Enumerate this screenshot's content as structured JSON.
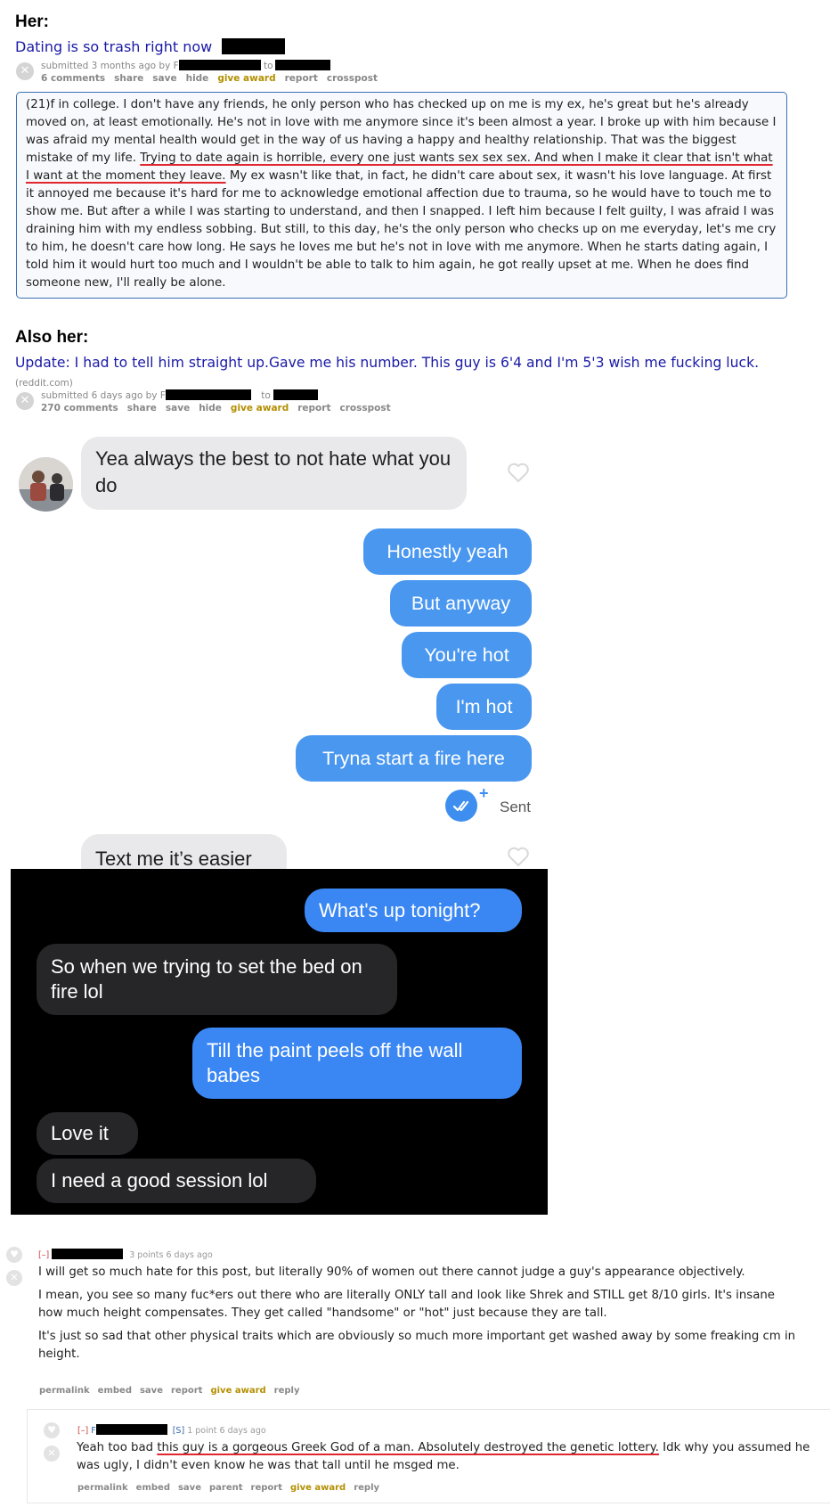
{
  "post1": {
    "heading": "Her:",
    "title": "Dating is so trash right now",
    "submitted": "submitted 3 months ago by F",
    "to": "to",
    "actions": [
      "6 comments",
      "share",
      "save",
      "hide",
      "give award",
      "report",
      "crosspost"
    ],
    "selftext_before": "(21)f in college. I don't have any friends, he only person who has checked up on me is my ex, he's great but he's already moved on, at least emotionally. He's not in love with me anymore since it's been almost a year. I broke up with him because I was afraid my mental health would get in the way of us having a happy and healthy relationship. That was the biggest mistake of my life. ",
    "selftext_underlined": "Trying to date again is horrible, every one just wants sex sex sex. And when I make it clear that isn't what I want at the moment they leave.",
    "selftext_after": " My ex wasn't like that, in fact, he didn't care about sex, it wasn't his love language. At first it annoyed me because it's hard for me to acknowledge emotional affection due to trauma, so he would have to touch me to show me. But after a while I was starting to understand, and then I snapped. I left him because I felt guilty, I was afraid I was draining him with my endless sobbing. But still, to this day, he's the only person who checks up on me everyday, let's me cry to him, he doesn't care how long. He says he loves me but he's not in love with me anymore. When he starts dating again, I told him it would hurt too much and I wouldn't be able to talk to him again, he got really upset at me. When he does find someone new, I'll really be alone."
  },
  "post2": {
    "heading": "Also her:",
    "title": "Update: I had to tell him straight up.Gave me his number. This guy is 6'4 and I'm 5'3 wish me fucking luck.",
    "domain": "(reddit.com)",
    "submitted": "submitted 6 days ago by F",
    "to": "to",
    "actions": [
      "270 comments",
      "share",
      "save",
      "hide",
      "give award",
      "report",
      "crosspost"
    ]
  },
  "dating_chat": {
    "incoming_1": "Yea always the best to not hate what you do",
    "outgoing": [
      "Honestly yeah",
      "But anyway",
      "You're hot",
      "I'm hot",
      "Tryna start a fire here"
    ],
    "status": "Sent",
    "incoming_2": "Text me it’s easier"
  },
  "imessage_chat": {
    "messages": [
      {
        "side": "out",
        "text": "What's up tonight?"
      },
      {
        "side": "in",
        "text": "So when we trying to set the bed on fire lol"
      },
      {
        "side": "out",
        "text": "Till the paint peels off the wall babes"
      },
      {
        "side": "in",
        "text": "Love it"
      },
      {
        "side": "in",
        "text": "I need a good session lol"
      }
    ]
  },
  "comment1": {
    "collapse": "[–]",
    "tagline": "3 points 6 days ago",
    "paragraphs": [
      "I will get so much hate for this post, but literally 90% of women out there cannot judge a guy's appearance objectively.",
      "I mean, you see so many fuc*ers out there who are literally ONLY tall and look like Shrek and STILL get 8/10 girls. It's insane how much height compensates. They get called \"handsome\" or \"hot\" just because they are tall.",
      "It's just so sad that other physical traits which are obviously so much more important get washed away by some freaking cm in height."
    ],
    "actions": [
      "permalink",
      "embed",
      "save",
      "report",
      "give award",
      "reply"
    ]
  },
  "comment2": {
    "collapse": "[–]",
    "author_initial": "F",
    "flair": "[S]",
    "tagline": "1 point 6 days ago",
    "text_before": "Yeah too bad ",
    "text_underlined": "this guy is a gorgeous Greek God of a man. Absolutely destroyed the genetic lottery.",
    "text_after": " Idk why you assumed he was ugly, I didn't even know he was that tall until he msged me.",
    "actions": [
      "permalink",
      "embed",
      "save",
      "parent",
      "report",
      "give award",
      "reply"
    ]
  },
  "colors": {
    "link_blue": "#1a1aa6",
    "underline_red": "#e0262e",
    "bubble_blue": "#4a97f0",
    "ios_blue": "#3a87f3",
    "award_gold": "#b38f00"
  }
}
